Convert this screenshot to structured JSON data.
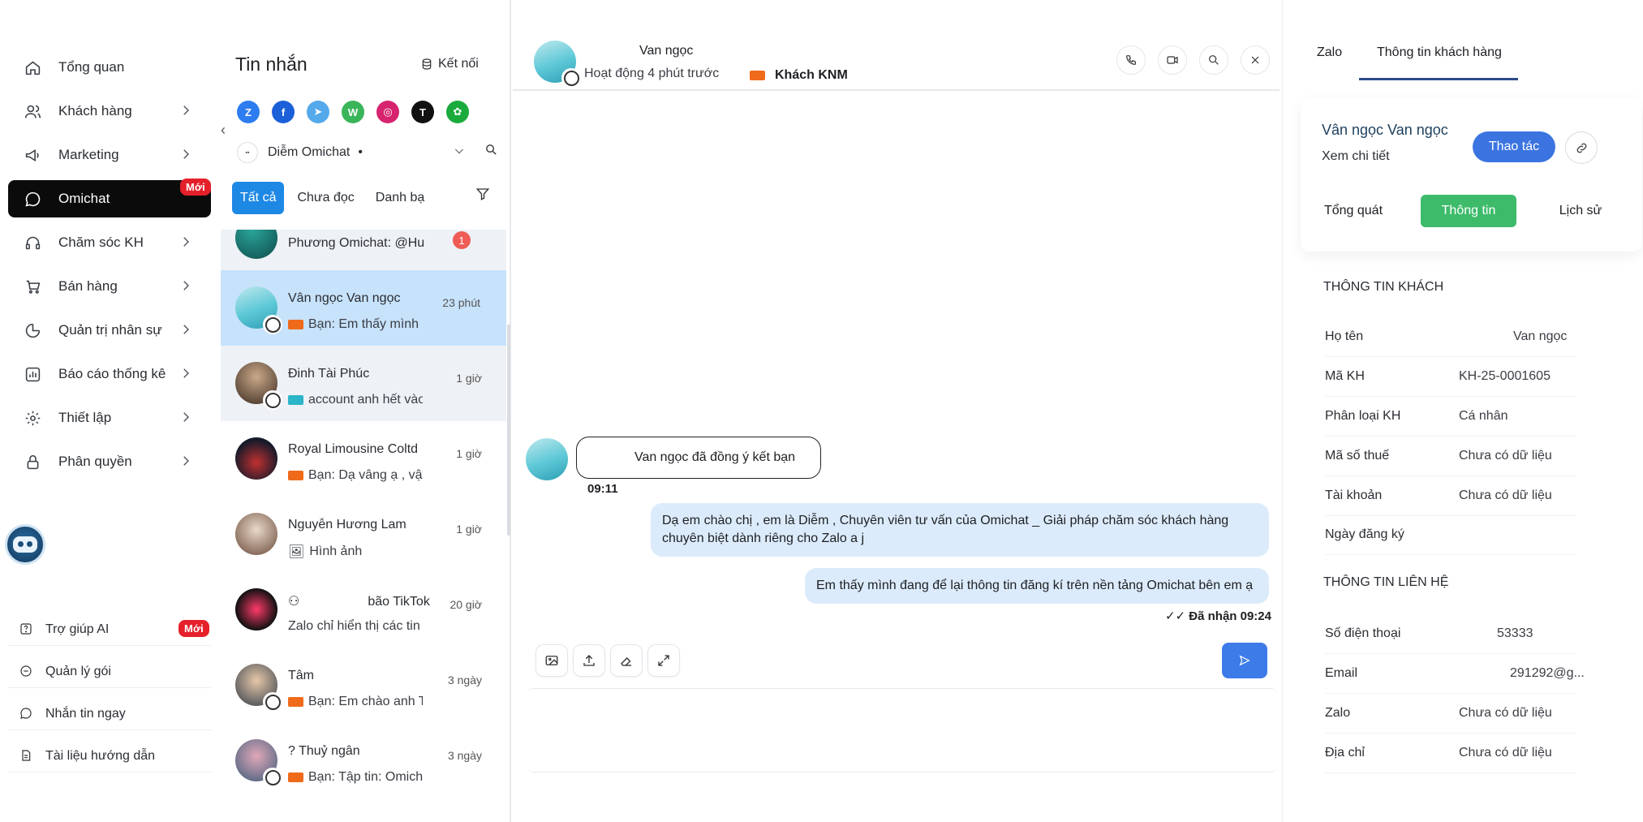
{
  "sidebar": {
    "items": [
      {
        "label": "Tổng quan",
        "icon": "home-icon"
      },
      {
        "label": "Khách hàng",
        "icon": "users-icon"
      },
      {
        "label": "Marketing",
        "icon": "megaphone-icon"
      },
      {
        "label": "Omichat",
        "icon": "chat-icon",
        "badge": "Mới"
      },
      {
        "label": "Chăm sóc KH",
        "icon": "headset-icon"
      },
      {
        "label": "Bán hàng",
        "icon": "cart-icon"
      },
      {
        "label": "Quản trị nhân sự",
        "icon": "pie-icon"
      },
      {
        "label": "Báo cáo thống kê",
        "icon": "chart-icon"
      },
      {
        "label": "Thiết lập",
        "icon": "gear-icon"
      },
      {
        "label": "Phân quyền",
        "icon": "lock-icon"
      }
    ],
    "help": [
      {
        "label": "Trợ giúp AI",
        "badge": "Mới"
      },
      {
        "label": "Quản lý gói"
      },
      {
        "label": "Nhắn tin ngay"
      },
      {
        "label": "Tài liệu hướng dẫn"
      }
    ]
  },
  "conv_list": {
    "title": "Tin nhắn",
    "connect_label": "Kết nối",
    "channels": [
      "Z",
      "f",
      "t",
      "W",
      "ig",
      "T",
      "wc"
    ],
    "account": "Diễm Omichat",
    "account_dot": "•",
    "tabs": [
      "Tất cả",
      "Chưa đọc",
      "Danh bạ"
    ],
    "conversations": [
      {
        "name": "Phương Omichat: @Hu",
        "time": "",
        "preview": "",
        "unread": "1"
      },
      {
        "name": "Vân ngọc Van ngọc",
        "time": "23 phút",
        "preview": "Bạn: Em thấy mình c"
      },
      {
        "name": "Đinh Tài Phúc",
        "time": "1 giờ",
        "preview": "account anh hết vào"
      },
      {
        "name": "Royal Limousine Coltd",
        "time": "1 giờ",
        "preview": "Bạn: Dạ vâng ạ , vậy"
      },
      {
        "name": "Nguyễn Hương Lam",
        "time": "1 giờ",
        "preview": "Hình ảnh"
      },
      {
        "name": "bão TikTok",
        "time": "20 giờ",
        "preview": "Zalo chỉ hiển thị các tin n"
      },
      {
        "name": "Tâm",
        "time": "3 ngày",
        "preview": "Bạn: Em chào anh Tâ"
      },
      {
        "name": "Thuỷ ngân",
        "time": "3 ngày",
        "preview": "Bạn: Tập tin: Omich"
      }
    ]
  },
  "chat": {
    "contact_name": "Van ngọc",
    "status": "Hoạt động 4 phút trước",
    "tag": "Khách KNM",
    "system_message": "Van ngọc đã đồng ý kết bạn",
    "system_time": "09:11",
    "messages": [
      {
        "text": "Dạ em chào chị , em là Diễm , Chuyên viên tư vấn của Omichat _ Giải pháp chăm sóc khách hàng chuyên biệt dành riêng cho Zalo a j"
      },
      {
        "text": "Em thấy mình đang để lại thông tin đăng kí trên nền tảng Omichat bên em ạ"
      }
    ],
    "delivered": "Đã nhận 09:24"
  },
  "right_panel": {
    "tabs": [
      "Zalo",
      "Thông tin khách hàng"
    ],
    "customer_name": "Vân ngọc Van ngọc",
    "view_detail": "Xem chi tiết",
    "action_label": "Thao tác",
    "subtabs": [
      "Tổng quát",
      "Thông tin",
      "Lịch sử"
    ],
    "section_customer": "THÔNG TIN KHÁCH",
    "customer_fields": [
      {
        "label": "Họ tên",
        "value": "Van ngọc"
      },
      {
        "label": "Mã KH",
        "value": "KH-25-0001605"
      },
      {
        "label": "Phân loại KH",
        "value": "Cá nhân"
      },
      {
        "label": "Mã số thuế",
        "value": "Chưa có dữ liệu"
      },
      {
        "label": "Tài khoản",
        "value": "Chưa có dữ liệu"
      },
      {
        "label": "Ngày đăng ký",
        "value": ""
      }
    ],
    "section_contact": "THÔNG TIN LIÊN HỆ",
    "contact_fields": [
      {
        "label": "Số điện thoại",
        "value": "53333"
      },
      {
        "label": "Email",
        "value": "291292@g..."
      },
      {
        "label": "Zalo",
        "value": "Chưa có dữ liệu"
      },
      {
        "label": "Địa chỉ",
        "value": "Chưa có dữ liệu"
      }
    ]
  },
  "colors": {
    "active_nav": "#0b0b0b",
    "badge_red": "#e5202a",
    "primary_blue": "#1e88e5",
    "send_blue": "#3d7be8",
    "info_green": "#3dbb6a",
    "tag_orange": "#f06a1c",
    "tag_teal": "#2bb5c8",
    "bubble_blue": "#dcebfb",
    "highlight_row": "#c7e2fb"
  }
}
